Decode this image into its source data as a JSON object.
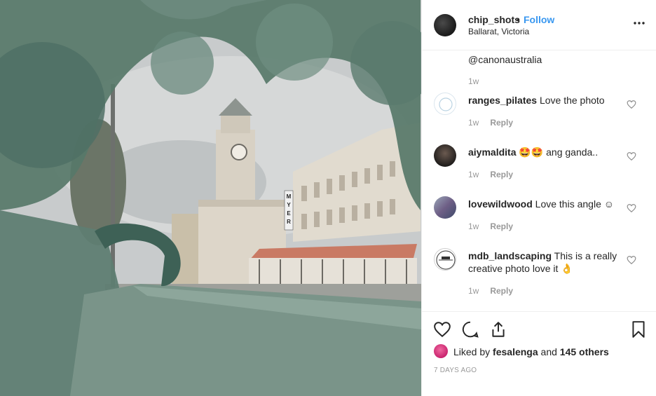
{
  "post": {
    "username": "chip_shots",
    "separator": "•",
    "follow_label": "Follow",
    "location": "Ballarat, Victoria"
  },
  "comments": {
    "partial_line": "@canonaustralia",
    "partial_time": "1w",
    "items": [
      {
        "username": "ranges_pilates",
        "text": "Love the photo",
        "time": "1w",
        "reply": "Reply"
      },
      {
        "username": "aiymaldita",
        "text": "🤩🤩 ang ganda..",
        "time": "1w",
        "reply": "Reply"
      },
      {
        "username": "lovewildwood",
        "text": "Love this angle ☺",
        "time": "1w",
        "reply": "Reply"
      },
      {
        "username": "mdb_landscaping",
        "text": "This is a really creative photo love it 👌",
        "time": "1w",
        "reply": "Reply"
      }
    ]
  },
  "likes": {
    "prefix": "Liked by",
    "user": "fesalenga",
    "joiner": "and",
    "others": "145 others"
  },
  "posted_ago": "7 DAYS AGO",
  "photo": {
    "building_sign": "MYER",
    "colors": {
      "rail": "#6f8d82",
      "sky": "#c8cbcc",
      "building": "#d9d2c6",
      "roof": "#c97a64"
    }
  },
  "icons": {
    "more": "more-options-icon",
    "heart": "heart-icon",
    "comment": "comment-icon",
    "share": "share-icon",
    "save": "bookmark-icon"
  }
}
